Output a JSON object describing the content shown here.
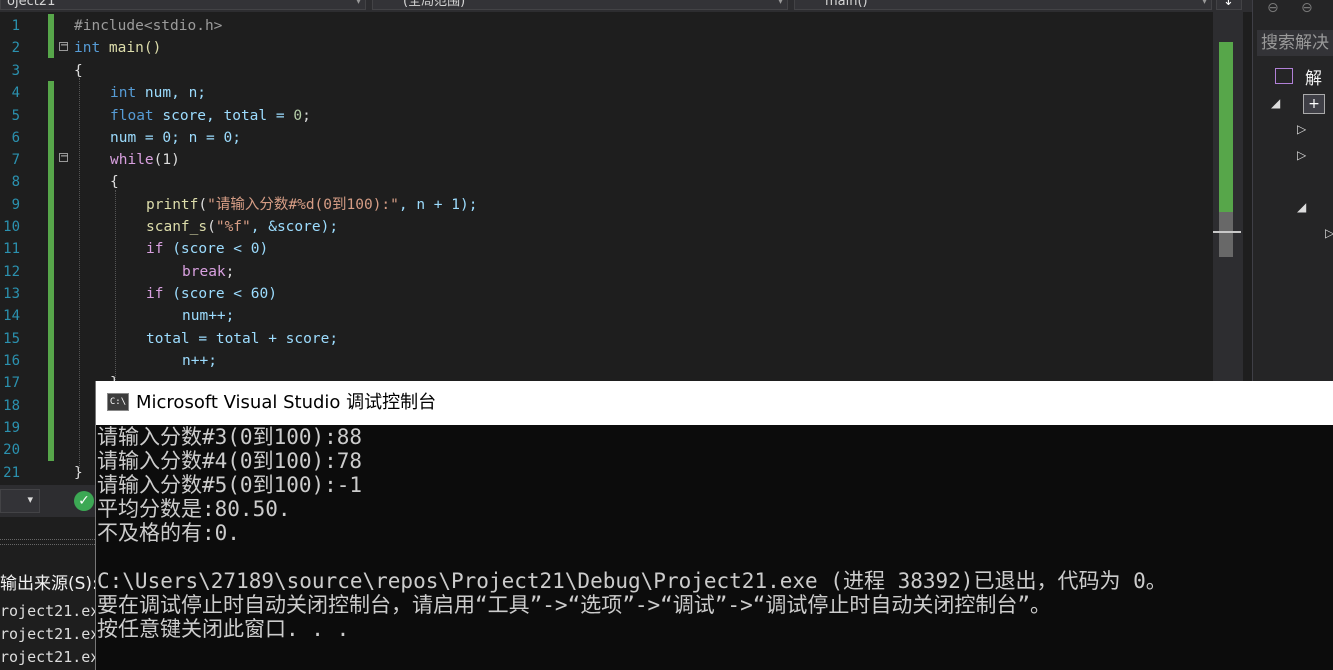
{
  "toolbar": {
    "project_combo": "oject21",
    "scope_combo": "(全局范围)",
    "member_combo": "main()"
  },
  "editor": {
    "line_numbers": [
      "1",
      "2",
      "3",
      "4",
      "5",
      "6",
      "7",
      "8",
      "9",
      "10",
      "11",
      "12",
      "13",
      "14",
      "15",
      "16",
      "17",
      "18",
      "19",
      "20",
      "21"
    ],
    "code": {
      "l1": "#include<stdio.h>",
      "l2_kw": "int",
      "l2_fn": " main()",
      "l3": "{",
      "l4_kw": "int",
      "l4_rest": " num, n;",
      "l5_kw": "float",
      "l5_rest": " score, total = ",
      "l5_num": "0",
      "l5_end": ";",
      "l6": "num = 0; n = 0;",
      "l7_kw": "while",
      "l7_rest": "(1)",
      "l8": "{",
      "l9_fn": "printf",
      "l9_open": "(",
      "l9_str": "\"请输入分数#%d(0到100):\"",
      "l9_rest": ", n + 1);",
      "l10_fn": "scanf_s",
      "l10_open": "(",
      "l10_str": "\"%f\"",
      "l10_rest": ", &score);",
      "l11_kw": "if",
      "l11_rest": " (score < 0)",
      "l12_kw": "break",
      "l12_rest": ";",
      "l13_kw": "if",
      "l13_rest": " (score < 60)",
      "l14": "num++;",
      "l15": "total = total + score;",
      "l16": "n++;",
      "l17": "}",
      "l21": "}"
    }
  },
  "solution_panel": {
    "search_placeholder": "搜索解决",
    "title": "解决"
  },
  "output_panel": {
    "source_label": "输出来源(S):",
    "lines": [
      "roject21.ex",
      "roject21.ex",
      "roject21.ex"
    ]
  },
  "console": {
    "title": "Microsoft Visual Studio 调试控制台",
    "icon_label": "C:\\",
    "lines": [
      "请输入分数#3(0到100):88",
      "请输入分数#4(0到100):78",
      "请输入分数#5(0到100):-1",
      "平均分数是:80.50.",
      "不及格的有:0.",
      "",
      "C:\\Users\\27189\\source\\repos\\Project21\\Debug\\Project21.exe (进程 38392)已退出，代码为 0。",
      "要在调试停止时自动关闭控制台，请启用“工具”->“选项”->“调试”->“调试停止时自动关闭控制台”。",
      "按任意键关闭此窗口. . ."
    ]
  },
  "colors": {
    "editor_bg": "#1e1e1e",
    "keyword": "#569cd6",
    "string": "#d69d85",
    "change_bar": "#57a64a",
    "console_bg": "#0c0c0c"
  }
}
